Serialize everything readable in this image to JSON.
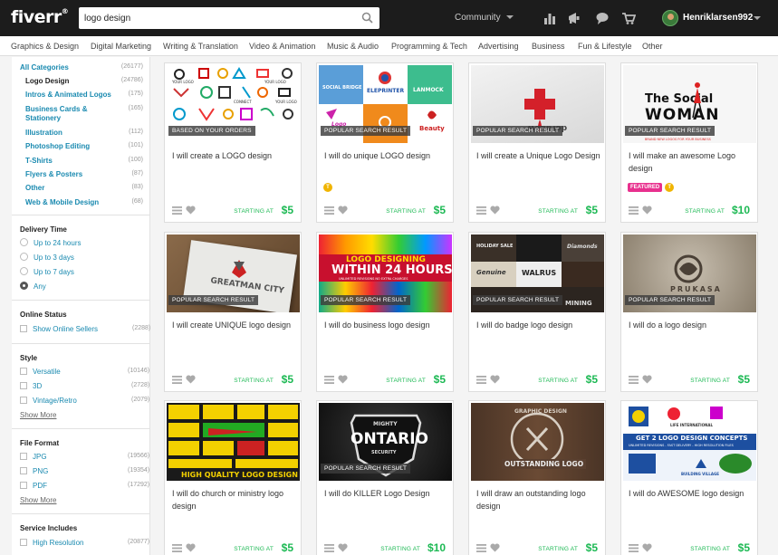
{
  "header": {
    "logo": "fiverr",
    "logo_tm": "®",
    "search_value": "logo design",
    "community_label": "Community",
    "username": "Henriklarsen992"
  },
  "categories": [
    "Graphics & Design",
    "Digital Marketing",
    "Writing & Translation",
    "Video & Animation",
    "Music & Audio",
    "Programming & Tech",
    "Advertising",
    "Business",
    "Fun & Lifestyle",
    "Other"
  ],
  "sidebar": {
    "all": {
      "label": "All Categories",
      "count": "(26177)"
    },
    "subcats": [
      {
        "label": "Logo Design",
        "count": "(24786)"
      },
      {
        "label": "Intros & Animated Logos",
        "count": "(175)"
      },
      {
        "label": "Business Cards &",
        "label2": "Stationery",
        "count": "(165)"
      },
      {
        "label": "Illustration",
        "count": "(112)"
      },
      {
        "label": "Photoshop Editing",
        "count": "(101)"
      },
      {
        "label": "T-Shirts",
        "count": "(100)"
      },
      {
        "label": "Flyers & Posters",
        "count": "(87)"
      },
      {
        "label": "Other",
        "count": "(83)"
      },
      {
        "label": "Web & Mobile Design",
        "count": "(68)"
      }
    ],
    "delivery": {
      "heading": "Delivery Time",
      "options": [
        "Up to 24 hours",
        "Up to 3 days",
        "Up to 7 days",
        "Any"
      ],
      "selected": "Any"
    },
    "online": {
      "heading": "Online Status",
      "option": "Show Online Sellers",
      "count": "(2288)"
    },
    "style": {
      "heading": "Style",
      "options": [
        {
          "label": "Versatile",
          "count": "(10146)"
        },
        {
          "label": "3D",
          "count": "(2728)"
        },
        {
          "label": "Vintage/Retro",
          "count": "(2079)"
        }
      ],
      "more": "Show More"
    },
    "format": {
      "heading": "File Format",
      "options": [
        {
          "label": "JPG",
          "count": "(19566)"
        },
        {
          "label": "PNG",
          "count": "(19354)"
        },
        {
          "label": "PDF",
          "count": "(17292)"
        }
      ],
      "more": "Show More"
    },
    "service": {
      "heading": "Service Includes",
      "options": [
        {
          "label": "High Resolution",
          "count": "(20877)"
        }
      ]
    }
  },
  "gigs": [
    {
      "badge": "BASED ON YOUR ORDERS",
      "title": "I will create a LOGO design",
      "starting": "STARTING AT",
      "price": "$5",
      "featured": "",
      "level": ""
    },
    {
      "badge": "POPULAR SEARCH RESULT",
      "title": "I will do unique LOGO design",
      "starting": "STARTING AT",
      "price": "$5",
      "featured": "",
      "level": "T"
    },
    {
      "badge": "POPULAR SEARCH RESULT",
      "title": "I will create a Unique Logo Design",
      "starting": "STARTING AT",
      "price": "$5",
      "featured": "",
      "level": ""
    },
    {
      "badge": "POPULAR SEARCH RESULT",
      "title": "I will make an awesome Logo design",
      "starting": "STARTING AT",
      "price": "$10",
      "featured": "FEATURED",
      "level": "T"
    },
    {
      "badge": "POPULAR SEARCH RESULT",
      "title": "I will create UNIQUE logo design",
      "starting": "STARTING AT",
      "price": "$5",
      "featured": "",
      "level": ""
    },
    {
      "badge": "POPULAR SEARCH RESULT",
      "title": "I will do business logo design",
      "starting": "STARTING AT",
      "price": "$5",
      "featured": "",
      "level": ""
    },
    {
      "badge": "POPULAR SEARCH RESULT",
      "title": "I will do badge logo design",
      "starting": "STARTING AT",
      "price": "$5",
      "featured": "",
      "level": ""
    },
    {
      "badge": "POPULAR SEARCH RESULT",
      "title": "I will do a logo design",
      "starting": "STARTING AT",
      "price": "$5",
      "featured": "",
      "level": ""
    },
    {
      "badge": "",
      "title": "I will do church or ministry logo design",
      "starting": "STARTING AT",
      "price": "$5",
      "featured": "",
      "level": ""
    },
    {
      "badge": "POPULAR SEARCH RESULT",
      "title": "I will do KILLER Logo Design",
      "starting": "STARTING AT",
      "price": "$10",
      "featured": "",
      "level": ""
    },
    {
      "badge": "",
      "title": "I will draw an outstanding logo design",
      "starting": "STARTING AT",
      "price": "$5",
      "featured": "",
      "level": ""
    },
    {
      "badge": "",
      "title": "I will do AWESOME logo design",
      "starting": "STARTING AT",
      "price": "$5",
      "featured": "",
      "level": ""
    }
  ],
  "thumb_text": {
    "t2": [
      "SOCIAL BRIDGE",
      "ELEPRINTER",
      "LANMOCK",
      "Beauty",
      "Logo"
    ],
    "t3": "doradow",
    "t4": [
      "The Social",
      "WOMAN",
      "BRAND NEW LOGOS FOR YOUR BUSINESS"
    ],
    "t5": "GREATMAN CITY",
    "t6": [
      "LOGO DESIGNING",
      "WITHIN 24 HOURS",
      "UNLIMITED REVISIONS  NO EXTRA CHARGES"
    ],
    "t7": [
      "Genuine",
      "WALRUS",
      "MINING",
      "Diamonds",
      "HOLIDAY SALE"
    ],
    "t8": "PRUKASA",
    "t9": "HIGH QUALITY LOGO DESIGN",
    "t10": [
      "MIGHTY",
      "ONTARIO",
      "SECURITY"
    ],
    "t11": [
      "GRAPHIC DESIGN",
      "OUTSTANDING LOGO"
    ],
    "t12": [
      "GET 2 LOGO DESIGN CONCEPTS",
      "UNLIMITED REVISIONS - FAST DELIVERY - HIGH RESOLUTION FILES",
      "LIFE INTERNATIONAL",
      "BUILDING VILLAGE"
    ]
  },
  "colors": {
    "accent_green": "#1db954",
    "link_blue": "#1a8ab0",
    "header_bg": "#1c1c1c",
    "featured_pink": "#e8308e"
  }
}
